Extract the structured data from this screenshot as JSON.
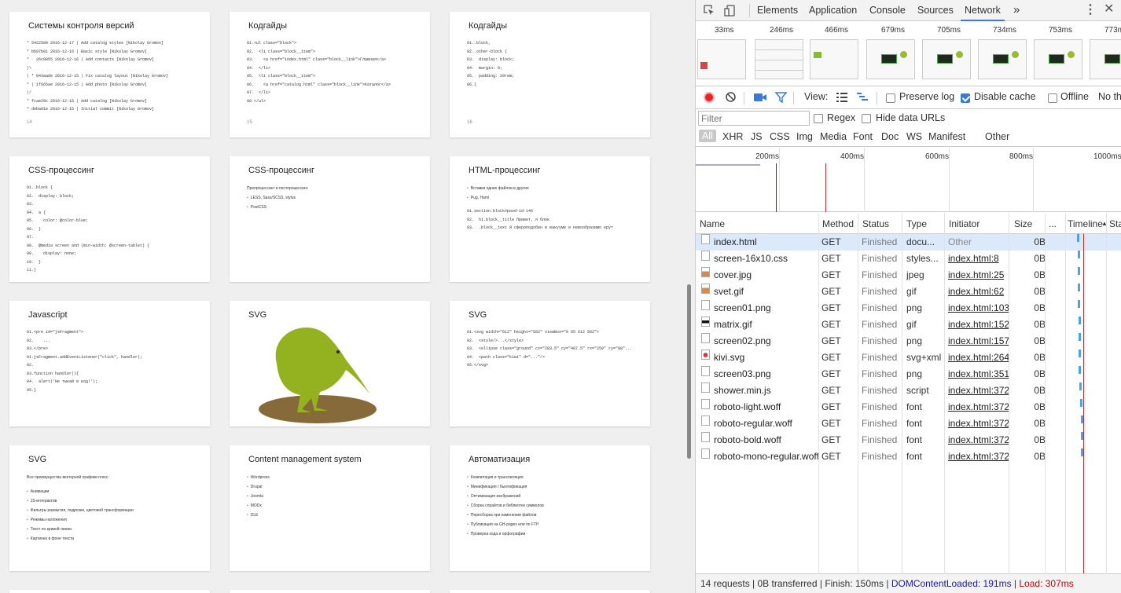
{
  "slides": [
    {
      "title": "Системы контроля версий",
      "page": "14",
      "code": true,
      "lines": [
        "* 5422589 2016-12-17 | Add catalog styles [Nikolay Gromov]",
        "* bb97b01 2016-12-16 | Basic style [Nikolay Gromov]",
        "*   26c8855 2016-12-16 | Add contacts [Nikolay Gromov]",
        "|\\",
        "| * 843aade 2016-12-15 | Fix catalog layout [Nikolay Gromov]",
        "* | 1f665ae 2016-12-15 | Add photo [Nikolay Gromov]",
        "|/",
        "* fcae29c 2016-12-15 | Add catalog [Nikolay Gromov]",
        "* deba91e 2016-12-15 | Initial commit [Nikolay Gromov]"
      ]
    },
    {
      "title": "Кодгайды",
      "page": "15",
      "code": true,
      "lines": [
        "01.<ul class=\"block\">",
        "02.  <li class=\"block__item\">",
        "03.    <a href=\"index.html\" class=\"block__link\">Главная</a>",
        "04.  </li>",
        "05.  <li class=\"block__item\">",
        "06.    <a href=\"catalog.html\" class=\"block__link\">Каталог</a>",
        "07.  </li>",
        "08.</ul>"
      ]
    },
    {
      "title": "Кодгайды",
      "page": "16",
      "code": true,
      "lines": [
        "01..block,",
        "02..other-block {",
        "03.  display: block;",
        "04.  margin: 0;",
        "05.  padding: 20rem;",
        "06.}"
      ]
    },
    {
      "title": "CSS-процессинг",
      "code": true,
      "lines": [
        "01..block {",
        "02.  display: block;",
        "03.",
        "04.  a {",
        "05.    color: @color-blue;",
        "06.  }",
        "07.",
        "08.  @media screen and (min-width: @screen-tablet) {",
        "09.    display: none;",
        "10.  }",
        "11.}"
      ]
    },
    {
      "title": "CSS-процессинг",
      "code": false,
      "bullets": [
        "LESS, Sass/SCSS, stylus",
        "PostCSS"
      ],
      "text": "Препроцессинг и постпроцессинг."
    },
    {
      "title": "HTML-процессинг",
      "code": false,
      "bullets": [
        "Вставки одних файлов в другие",
        "Pug, Haml"
      ],
      "code2": [
        "01.section.block#posd-id-146",
        "02.  h1.block__title Привет, я блок",
        "03.  .block__text Я сфероподобен в вакууме и невообразимо крут"
      ]
    },
    {
      "title": "Javascript",
      "code": true,
      "lines": [
        "01.<pre id=\"jsFragment\">",
        "02.    ...",
        "03.</pre>",
        "",
        "01.jsFragment.addEventListener(\"click\", handler);",
        "02.",
        "03.function handler(){",
        "04.  alert('Не тыкай в код!');",
        "05.}"
      ]
    },
    {
      "title": "SVG",
      "code": false,
      "kiwi": true
    },
    {
      "title": "SVG",
      "code": true,
      "lines": [
        "01.<svg width=\"612\" height=\"502\" viewBox=\"0 65 612 502\">",
        "02.  <style/>...</style>",
        "03.  <ellipse class=\"ground\" cx=\"283.5\" cy=\"487.5\" rx=\"259\" ry=\"80\"...",
        "04.  <path class=\"kiwi\" d=\"...\"/>",
        "05.</svg>"
      ]
    },
    {
      "title": "SVG",
      "code": false,
      "text": "Все преимущества векторной графики плюс:",
      "bullets2": [
        "Анимации",
        "JS-интерактив",
        "Фильтры размытия, подрезки, цветовой трансформации",
        "Режимы наложения",
        "Текст по кривой линии",
        "Картинка в фоне текста"
      ]
    },
    {
      "title": "Content management system",
      "code": false,
      "bullets": [
        "Wordpress",
        "Drupal",
        "Joomla",
        "MODx",
        "DLE"
      ]
    },
    {
      "title": "Автоматизация",
      "code": false,
      "bullets": [
        "Компиляция и транспиляция",
        "Минификация / бьютификация",
        "Оптимизация изображений",
        "Сборка спрайтов и библиотек символов",
        "Пересборка при изменении файлов",
        "Публикация на GH-pages или по FTP",
        "Проверка кода и орфографии"
      ]
    }
  ],
  "devtools": {
    "tabs": [
      "Elements",
      "Application",
      "Console",
      "Sources",
      "Network"
    ],
    "more": "»",
    "frames": [
      "33ms",
      "246ms",
      "466ms",
      "679ms",
      "705ms",
      "734ms",
      "753ms",
      "773ms"
    ],
    "view_label": "View:",
    "preserve_log": "Preserve log",
    "disable_cache": "Disable cache",
    "offline": "Offline",
    "throttle": "No th",
    "filter_placeholder": "Filter",
    "regex": "Regex",
    "hide_data": "Hide data URLs",
    "types": [
      "All",
      "XHR",
      "JS",
      "CSS",
      "Img",
      "Media",
      "Font",
      "Doc",
      "WS",
      "Manifest",
      "Other"
    ],
    "ticks": [
      "200ms",
      "400ms",
      "600ms",
      "800ms",
      "1000ms"
    ],
    "columns": {
      "name": "Name",
      "method": "Method",
      "status": "Status",
      "type": "Type",
      "initiator": "Initiator",
      "size": "Size",
      "dots": "...",
      "timeline": "Timeline",
      "timeline_sort": "▲",
      "status2": "Sta"
    },
    "requests": [
      {
        "name": "index.html",
        "method": "GET",
        "status": "Finished",
        "type": "docu...",
        "initiator": "Other",
        "size": "0B",
        "icon": "doc"
      },
      {
        "name": "screen-16x10.css",
        "method": "GET",
        "status": "Finished",
        "type": "styles...",
        "initiator": "index.html:8",
        "size": "0B",
        "icon": "doc"
      },
      {
        "name": "cover.jpg",
        "method": "GET",
        "status": "Finished",
        "type": "jpeg",
        "initiator": "index.html:25",
        "size": "0B",
        "icon": "img"
      },
      {
        "name": "svet.gif",
        "method": "GET",
        "status": "Finished",
        "type": "gif",
        "initiator": "index.html:62",
        "size": "0B",
        "icon": "img"
      },
      {
        "name": "screen01.png",
        "method": "GET",
        "status": "Finished",
        "type": "png",
        "initiator": "index.html:103",
        "size": "0B",
        "icon": "doc"
      },
      {
        "name": "matrix.gif",
        "method": "GET",
        "status": "Finished",
        "type": "gif",
        "initiator": "index.html:152",
        "size": "0B",
        "icon": "dark"
      },
      {
        "name": "screen02.png",
        "method": "GET",
        "status": "Finished",
        "type": "png",
        "initiator": "index.html:157",
        "size": "0B",
        "icon": "doc"
      },
      {
        "name": "kivi.svg",
        "method": "GET",
        "status": "Finished",
        "type": "svg+xml",
        "initiator": "index.html:264",
        "size": "0B",
        "icon": "red"
      },
      {
        "name": "screen03.png",
        "method": "GET",
        "status": "Finished",
        "type": "png",
        "initiator": "index.html:351",
        "size": "0B",
        "icon": "doc"
      },
      {
        "name": "shower.min.js",
        "method": "GET",
        "status": "Finished",
        "type": "script",
        "initiator": "index.html:372",
        "size": "0B",
        "icon": "doc"
      },
      {
        "name": "roboto-light.woff",
        "method": "GET",
        "status": "Finished",
        "type": "font",
        "initiator": "index.html:372",
        "size": "0B",
        "icon": "doc"
      },
      {
        "name": "roboto-regular.woff",
        "method": "GET",
        "status": "Finished",
        "type": "font",
        "initiator": "index.html:372",
        "size": "0B",
        "icon": "doc"
      },
      {
        "name": "roboto-bold.woff",
        "method": "GET",
        "status": "Finished",
        "type": "font",
        "initiator": "index.html:372",
        "size": "0B",
        "icon": "doc"
      },
      {
        "name": "roboto-mono-regular.woff",
        "method": "GET",
        "status": "Finished",
        "type": "font",
        "initiator": "index.html:372",
        "size": "0B",
        "icon": "doc"
      }
    ],
    "status_summary": "14 requests | 0B transferred | Finish: 150ms |",
    "dom_loaded": "DOMContentLoaded: 191ms",
    "load": "Load: 307ms"
  }
}
